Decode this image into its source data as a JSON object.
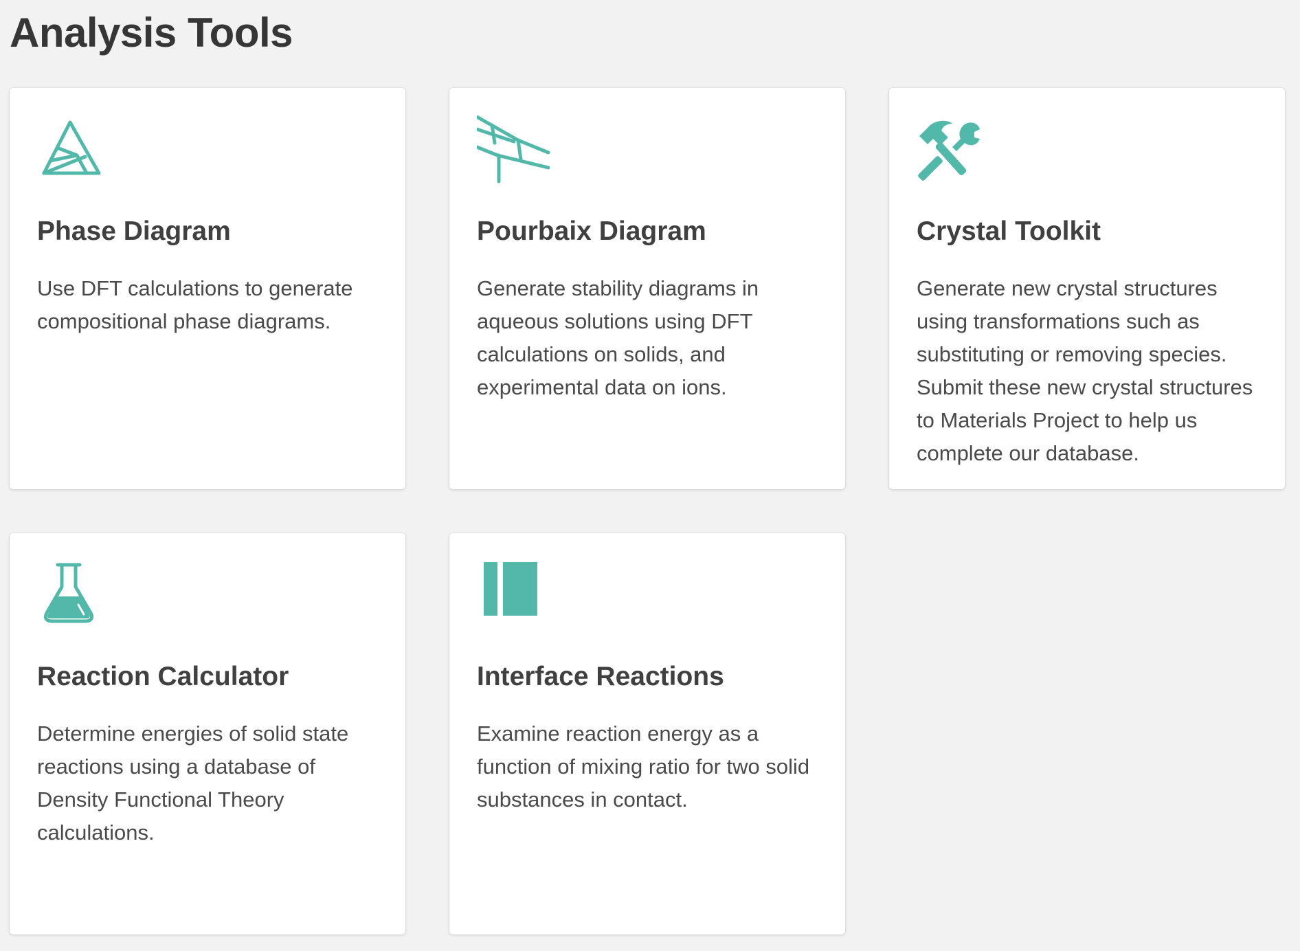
{
  "page": {
    "title": "Analysis Tools"
  },
  "colors": {
    "accent": "#52b8a9",
    "background": "#f2f2f2",
    "card": "#ffffff"
  },
  "cards": [
    {
      "title": "Phase Diagram",
      "description": "Use DFT calculations to generate compositional phase diagrams.",
      "icon": "phase-diagram-icon"
    },
    {
      "title": "Pourbaix Diagram",
      "description": "Generate stability diagrams in aqueous solutions using DFT calculations on solids, and experimental data on ions.",
      "icon": "pourbaix-diagram-icon"
    },
    {
      "title": "Crystal Toolkit",
      "description": "Generate new crystal structures using transformations such as substituting or removing species. Submit these new crystal structures to Materials Project to help us complete our database.",
      "icon": "hammer-wrench-icon"
    },
    {
      "title": "Reaction Calculator",
      "description": "Determine energies of solid state reactions using a database of Density Functional Theory calculations.",
      "icon": "flask-icon"
    },
    {
      "title": "Interface Reactions",
      "description": "Examine reaction energy as a function of mixing ratio for two solid substances in contact.",
      "icon": "interface-bars-icon"
    }
  ]
}
